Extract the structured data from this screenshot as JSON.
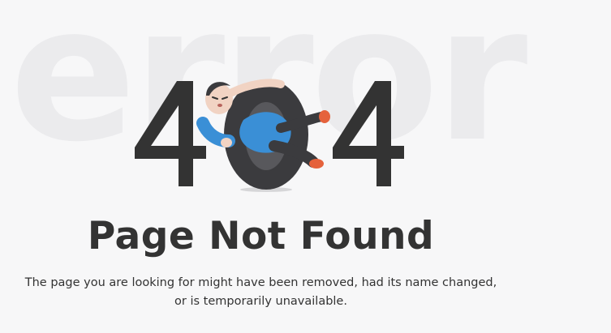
{
  "background_word": "error",
  "hero": {
    "digit_left": "4",
    "digit_middle": "0",
    "digit_right": "4",
    "illustration": "man-hugging-zero-icon"
  },
  "title": "Page Not Found",
  "description": {
    "line1": "The page you are looking for might have been removed, had its name changed,",
    "line2": "or is temporarily unavailable."
  },
  "colors": {
    "background": "#f7f7f8",
    "watermark": "#ebebed",
    "text": "#333333",
    "accent_blue": "#3a8fd6",
    "accent_orange": "#e5623c"
  }
}
